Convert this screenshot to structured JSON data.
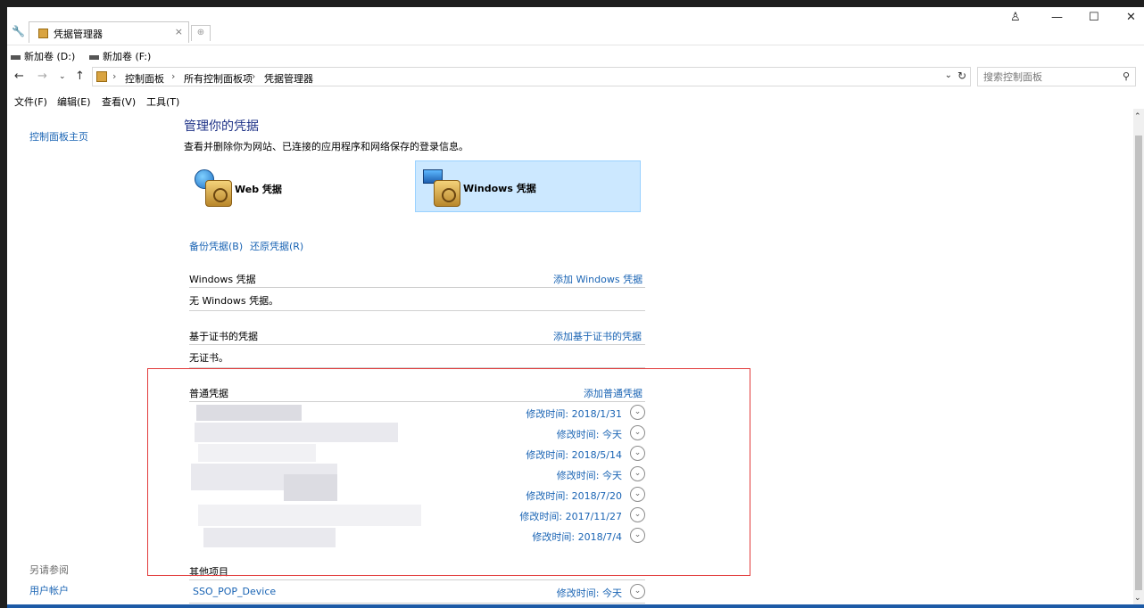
{
  "tab": {
    "title": "凭据管理器",
    "close": "×",
    "new_tab": "⊕"
  },
  "window_controls": {
    "user": "♙",
    "minimize": "—",
    "maximize": "☐",
    "close": "✕"
  },
  "quick_access": [
    {
      "label": "新加卷 (D:)"
    },
    {
      "label": "新加卷 (F:)"
    }
  ],
  "address": {
    "crumbs": [
      "控制面板",
      "所有控制面板项",
      "凭据管理器"
    ],
    "separator": "›",
    "search_placeholder": "搜索控制面板"
  },
  "menu": [
    "文件(F)",
    "编辑(E)",
    "查看(V)",
    "工具(T)"
  ],
  "left_pane": {
    "home": "控制面板主页",
    "see_also": "另请参阅",
    "user_accounts": "用户帐户"
  },
  "main": {
    "title": "管理你的凭据",
    "description": "查看并删除你为网站、已连接的应用程序和网络保存的登录信息。",
    "categories": [
      {
        "label": "Web 凭据",
        "selected": false
      },
      {
        "label": "Windows 凭据",
        "selected": true
      }
    ],
    "backup": "备份凭据(B)",
    "restore": "还原凭据(R)",
    "windows_section": {
      "header": "Windows 凭据",
      "add": "添加 Windows 凭据",
      "empty": "无 Windows 凭据。"
    },
    "cert_section": {
      "header": "基于证书的凭据",
      "add": "添加基于证书的凭据",
      "empty": "无证书。"
    },
    "generic_section": {
      "header": "普通凭据",
      "add": "添加普通凭据",
      "rows": [
        {
          "modified": "修改时间:  2018/1/31"
        },
        {
          "modified": "修改时间:  今天"
        },
        {
          "modified": "修改时间:  2018/5/14"
        },
        {
          "modified": "修改时间:  今天"
        },
        {
          "modified": "修改时间:  2018/7/20"
        },
        {
          "modified": "修改时间:  2017/11/27"
        },
        {
          "modified": "修改时间:  2018/7/4"
        }
      ]
    },
    "other_section": {
      "header": "其他项目",
      "rows": [
        {
          "name": "SSO_POP_Device",
          "modified": "修改时间:  今天"
        }
      ]
    }
  },
  "colors": {
    "link": "#1a64b4",
    "title": "#1e3287",
    "selection": "#cce8ff",
    "highlight_box": "#e23b3b"
  }
}
